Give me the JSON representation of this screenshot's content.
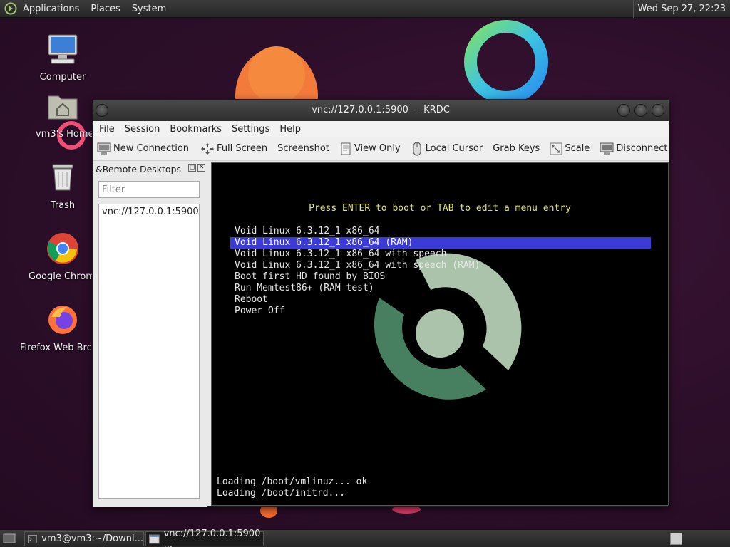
{
  "top_panel": {
    "menus": [
      "Applications",
      "Places",
      "System"
    ],
    "clock": "Wed Sep 27, 22:23"
  },
  "desktop_icons": [
    {
      "label": "Computer",
      "icon": "computer-icon"
    },
    {
      "label": "vm3's Home",
      "icon": "home-folder-icon"
    },
    {
      "label": "Trash",
      "icon": "trash-icon"
    },
    {
      "label": "Google Chrome",
      "icon": "chrome-icon"
    },
    {
      "label": "Firefox Web Browser",
      "icon": "firefox-icon"
    }
  ],
  "window": {
    "title": "vnc://127.0.0.1:5900 — KRDC",
    "menu": [
      "File",
      "Session",
      "Bookmarks",
      "Settings",
      "Help"
    ],
    "toolbar": {
      "new_connection": "New Connection",
      "full_screen": "Full Screen",
      "screenshot": "Screenshot",
      "view_only": "View Only",
      "local_cursor": "Local Cursor",
      "grab_keys": "Grab Keys",
      "scale": "Scale",
      "disconnect": "Disconnect"
    },
    "dock": {
      "title": "&Remote Desktops",
      "filter_placeholder": "Filter",
      "connections": [
        "vnc://127.0.0.1:5900"
      ]
    }
  },
  "vnc_screen": {
    "header": "Press ENTER to boot or TAB to edit a menu entry",
    "entries": [
      "Void Linux 6.3.12_1 x86_64",
      "Void Linux 6.3.12_1 x86_64 (RAM)",
      "Void Linux 6.3.12_1 x86_64 with speech",
      "Void Linux 6.3.12_1 x86_64 with speech (RAM)",
      "Boot first HD found by BIOS",
      "Run Memtest86+ (RAM test)",
      "Reboot",
      "Power Off"
    ],
    "selected_index": 1,
    "selection_color": "#3b3bd6",
    "loading": [
      "Loading /boot/vmlinuz... ok",
      "Loading /boot/initrd..."
    ]
  },
  "taskbar": {
    "tasks": [
      {
        "label": "vm3@vm3:~/Downl...",
        "icon": "terminal-icon"
      },
      {
        "label": "vnc://127.0.0.1:5900 ...",
        "icon": "window-icon"
      }
    ]
  }
}
